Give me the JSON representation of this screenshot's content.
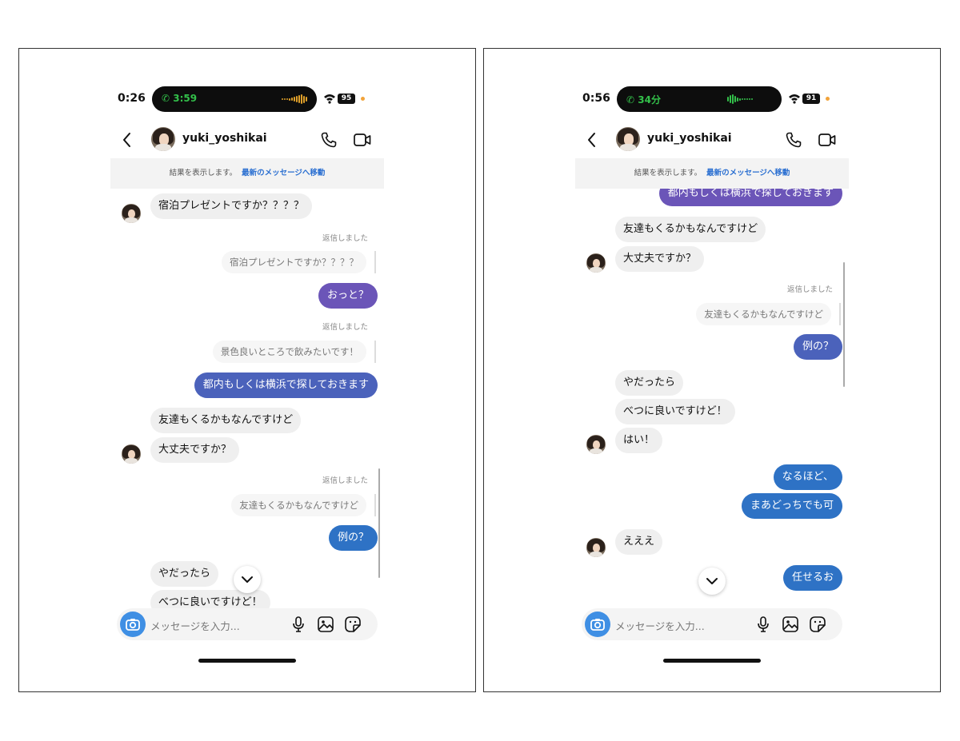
{
  "colors": {
    "purple": "#6b55b8",
    "indigo": "#4b62bb",
    "blue": "#2e72c5",
    "call_green": "#33c04a",
    "link_blue": "#2a6fd1"
  },
  "left": {
    "status": {
      "time": "0:26",
      "call": "3:59",
      "battery": "95"
    },
    "header": {
      "username": "yuki_yoshikai"
    },
    "banner": {
      "text": "結果を表示します。",
      "link": "最新のメッセージへ移動"
    },
    "input": {
      "placeholder": "メッセージを入力..."
    },
    "messages": [
      {
        "type": "in",
        "text": "宿泊プレゼントですか？？？？"
      },
      {
        "type": "replied",
        "text": "返信しました"
      },
      {
        "type": "quote",
        "text": "宿泊プレゼントですか？？？？"
      },
      {
        "type": "out",
        "text": "おっと？"
      },
      {
        "type": "replied",
        "text": "返信しました"
      },
      {
        "type": "quote",
        "text": "景色良いところで飲みたいです！"
      },
      {
        "type": "out",
        "text": "都内もしくは横浜で探しておきます"
      },
      {
        "type": "in",
        "text": "友達もくるかもなんですけど"
      },
      {
        "type": "in",
        "text": "大丈夫ですか？"
      },
      {
        "type": "replied",
        "text": "返信しました"
      },
      {
        "type": "quote",
        "text": "友達もくるかもなんですけど"
      },
      {
        "type": "out",
        "text": "例の？"
      },
      {
        "type": "in",
        "text": "やだったら"
      },
      {
        "type": "in",
        "text": "べつに良いですけど！"
      }
    ]
  },
  "right": {
    "status": {
      "time": "0:56",
      "call": "34分",
      "battery": "91"
    },
    "header": {
      "username": "yuki_yoshikai"
    },
    "banner": {
      "text": "結果を表示します。",
      "link": "最新のメッセージへ移動"
    },
    "input": {
      "placeholder": "メッセージを入力..."
    },
    "messages": [
      {
        "type": "out",
        "text": "都内もしくは横浜で探しておきます"
      },
      {
        "type": "in",
        "text": "友達もくるかもなんですけど"
      },
      {
        "type": "in",
        "text": "大丈夫ですか？"
      },
      {
        "type": "replied",
        "text": "返信しました"
      },
      {
        "type": "quote",
        "text": "友達もくるかもなんですけど"
      },
      {
        "type": "out",
        "text": "例の？"
      },
      {
        "type": "in",
        "text": "やだったら"
      },
      {
        "type": "in",
        "text": "べつに良いですけど！"
      },
      {
        "type": "in",
        "text": "はい！"
      },
      {
        "type": "out",
        "text": "なるほど、"
      },
      {
        "type": "out",
        "text": "まあどっちでも可"
      },
      {
        "type": "in",
        "text": "えええ"
      },
      {
        "type": "out",
        "text": "任せるお"
      }
    ]
  }
}
